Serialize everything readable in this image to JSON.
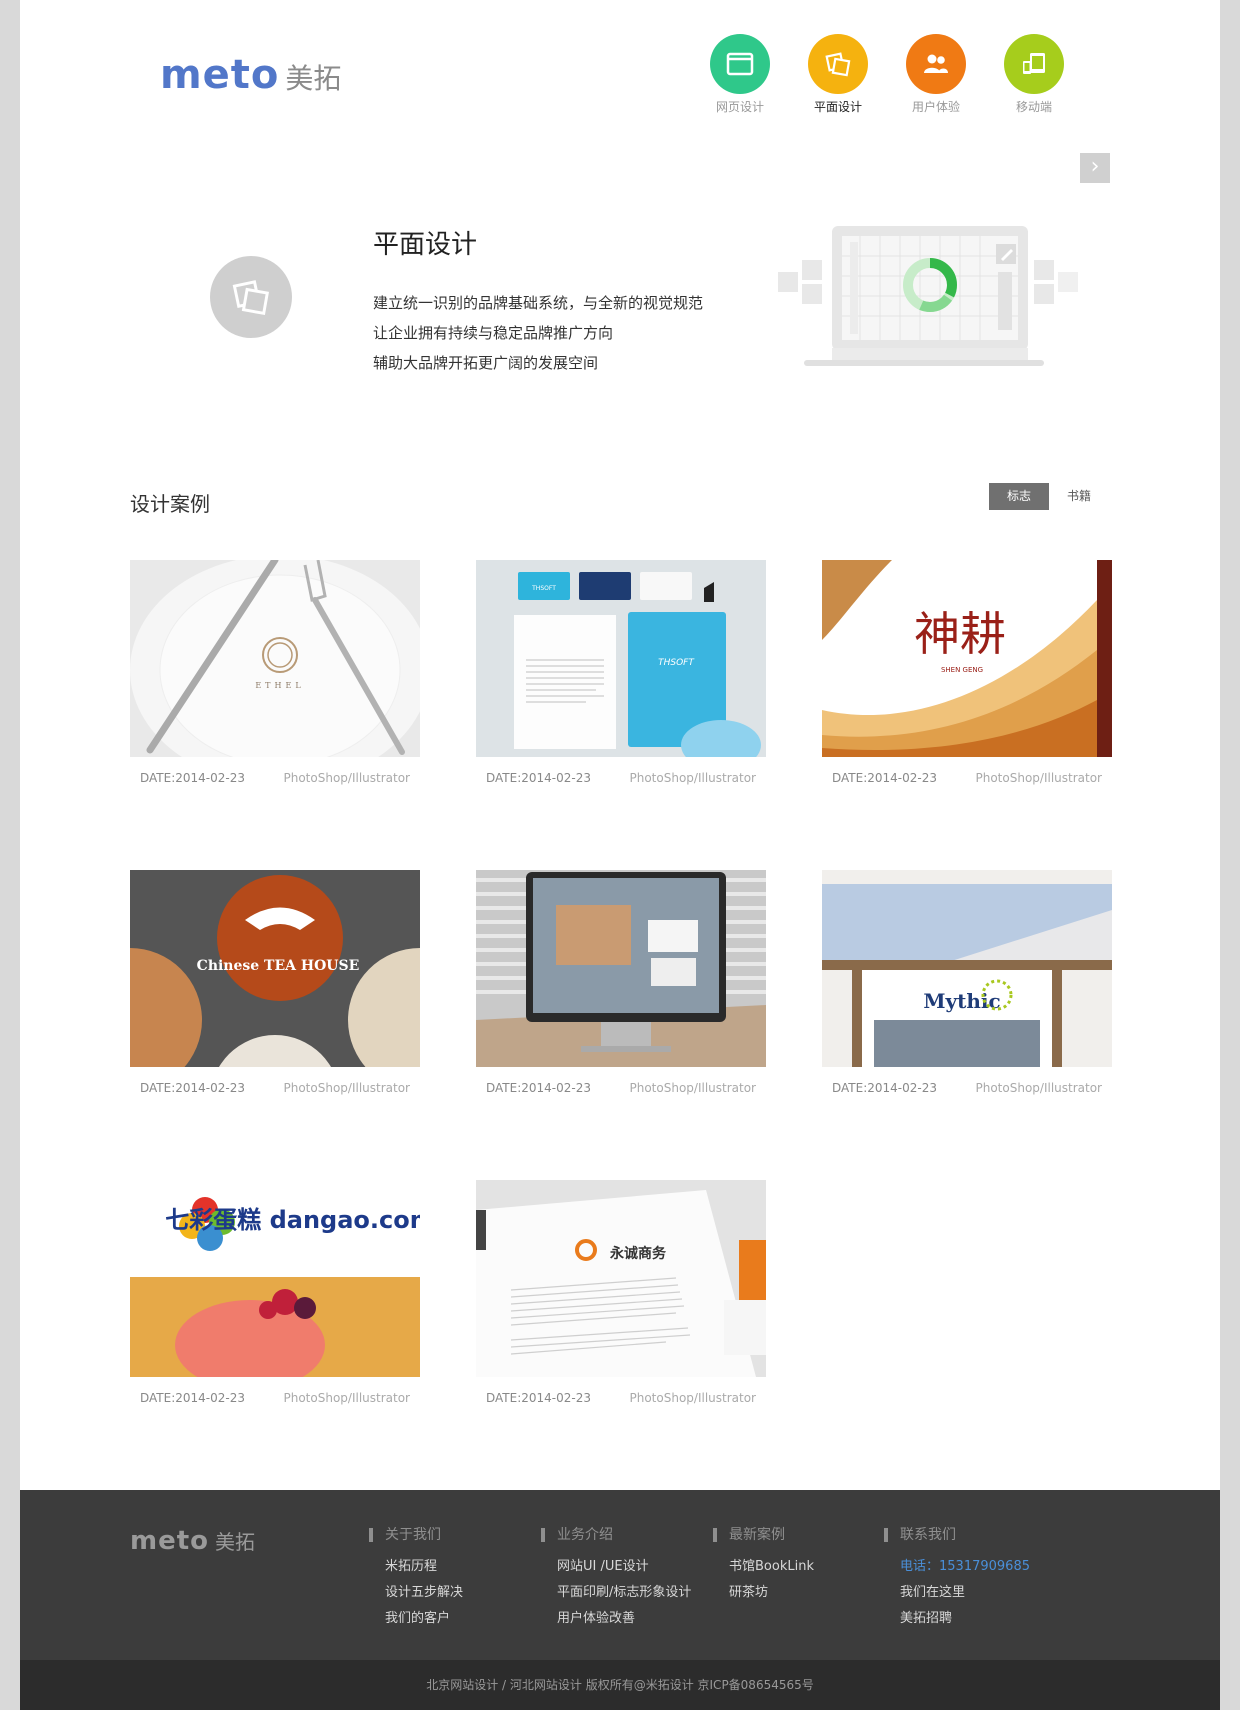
{
  "brand": {
    "logo_en": "meto",
    "logo_cn": "美拓"
  },
  "nav": [
    {
      "label": "网页设计",
      "color": "#2fc88a",
      "icon": "browser-window-icon"
    },
    {
      "label": "平面设计",
      "color": "#f5b20f",
      "icon": "overlapping-cards-icon"
    },
    {
      "label": "用户体验",
      "color": "#f07a14",
      "icon": "users-icon"
    },
    {
      "label": "移动端",
      "color": "#a6cd1c",
      "icon": "devices-icon"
    }
  ],
  "next_arrow": "›",
  "hero": {
    "title": "平面设计",
    "lines": [
      "建立统一识别的品牌基础系统，与全新的视觉规范",
      "让企业拥有持续与稳定品牌推广方向",
      "辅助大品牌开拓更广阔的发展空间"
    ]
  },
  "cases": {
    "title": "设计案例",
    "tabs": [
      "标志",
      "书籍"
    ],
    "items": [
      {
        "date": "DATE:2014-02-23",
        "tool": "PhotoShop/Illustrator",
        "art_text": "ETHEL"
      },
      {
        "date": "DATE:2014-02-23",
        "tool": "PhotoShop/Illustrator",
        "art_text": "THSOFT"
      },
      {
        "date": "DATE:2014-02-23",
        "tool": "PhotoShop/Illustrator",
        "art_text": "神耕"
      },
      {
        "date": "DATE:2014-02-23",
        "tool": "PhotoShop/Illustrator",
        "art_text": "Chinese TEA HOUSE"
      },
      {
        "date": "DATE:2014-02-23",
        "tool": "PhotoShop/Illustrator",
        "art_text": ""
      },
      {
        "date": "DATE:2014-02-23",
        "tool": "PhotoShop/Illustrator",
        "art_text": "Mythic"
      },
      {
        "date": "DATE:2014-02-23",
        "tool": "PhotoShop/Illustrator",
        "art_text": "七彩蛋糕 dangao.com"
      },
      {
        "date": "DATE:2014-02-23",
        "tool": "PhotoShop/Illustrator",
        "art_text": "永诚商务"
      }
    ]
  },
  "footer": {
    "columns": [
      {
        "title": "关于我们",
        "links": [
          "米拓历程",
          "设计五步解决",
          "我们的客户"
        ]
      },
      {
        "title": "业务介绍",
        "links": [
          "网站UI /UE设计",
          "平面印刷/标志形象设计",
          "用户体验改善"
        ]
      },
      {
        "title": "最新案例",
        "links": [
          "书馆BookLink",
          "研茶坊"
        ]
      },
      {
        "title": "联系我们",
        "links": [
          "电话：15317909685",
          "我们在这里",
          "美拓招聘"
        ]
      }
    ],
    "copyright": "北京网站设计 / 河北网站设计 版权所有@米拓设计  京ICP备08654565号"
  }
}
